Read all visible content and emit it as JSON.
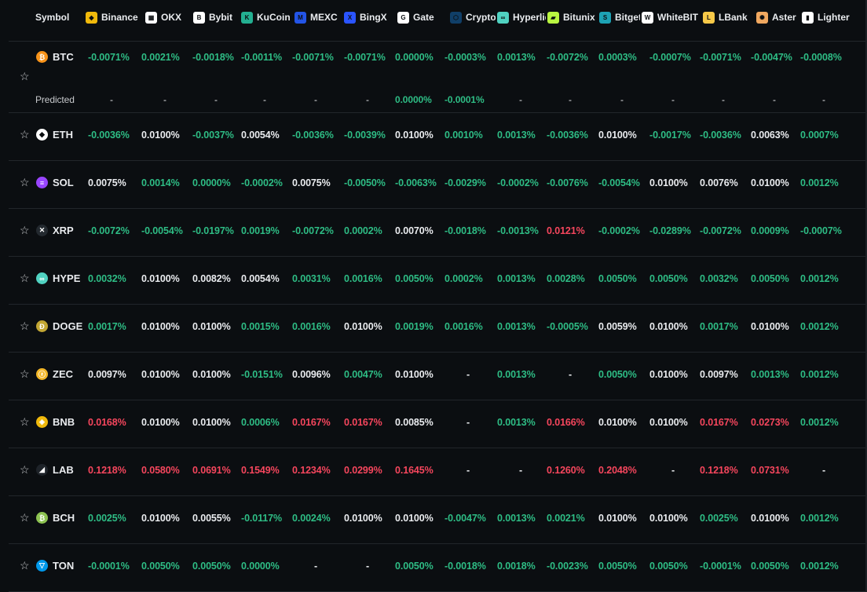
{
  "header": {
    "symbol_label": "Symbol",
    "exchanges": [
      {
        "name": "Binance",
        "icon": "binance-icon",
        "color": "#f0b90b"
      },
      {
        "name": "OKX",
        "icon": "okx-icon",
        "color": "#ffffff"
      },
      {
        "name": "Bybit",
        "icon": "bybit-icon",
        "color": "#ffffff"
      },
      {
        "name": "KuCoin",
        "icon": "kucoin-icon",
        "color": "#23af91"
      },
      {
        "name": "MEXC",
        "icon": "mexc-icon",
        "color": "#2354e6"
      },
      {
        "name": "BingX",
        "icon": "bingx-icon",
        "color": "#2a54ff"
      },
      {
        "name": "Gate",
        "icon": "gate-icon",
        "color": "#ffffff"
      },
      {
        "name": "Crypto.com",
        "icon": "cryptocom-icon",
        "color": "#103f68"
      },
      {
        "name": "Hyperliqui",
        "icon": "hyperliquid-icon",
        "color": "#50d2c1"
      },
      {
        "name": "Bitunix",
        "icon": "bitunix-icon",
        "color": "#b9f641"
      },
      {
        "name": "Bitget",
        "icon": "bitget-icon",
        "color": "#1da2b4"
      },
      {
        "name": "WhiteBIT",
        "icon": "whitebit-icon",
        "color": "#ffffff"
      },
      {
        "name": "LBank",
        "icon": "lbank-icon",
        "color": "#f7c948"
      },
      {
        "name": "Aster",
        "icon": "aster-icon",
        "color": "#f0a860"
      },
      {
        "name": "Lighter",
        "icon": "lighter-icon",
        "color": "#ffffff"
      }
    ]
  },
  "colors": {
    "positive": "#2ebd85",
    "negative": "#f6465d",
    "neutral": "#eaecef",
    "background": "#0b0e11"
  },
  "predicted_label": "Predicted",
  "rows": [
    {
      "symbol": "BTC",
      "icon": "btc-icon",
      "coin_color": "#f7931a",
      "values": [
        "-0.0071%",
        "0.0021%",
        "-0.0018%",
        "-0.0011%",
        "-0.0071%",
        "-0.0071%",
        "0.0000%",
        "-0.0003%",
        "0.0013%",
        "-0.0072%",
        "0.0003%",
        "-0.0007%",
        "-0.0071%",
        "-0.0047%",
        "-0.0008%"
      ],
      "tones": [
        "pos",
        "pos",
        "pos",
        "pos",
        "pos",
        "pos",
        "pos",
        "pos",
        "pos",
        "pos",
        "pos",
        "pos",
        "pos",
        "pos",
        "pos"
      ],
      "predicted": [
        "-",
        "-",
        "-",
        "-",
        "-",
        "-",
        "0.0000%",
        "-0.0001%",
        "-",
        "-",
        "-",
        "-",
        "-",
        "-",
        "-"
      ],
      "predicted_tones": [
        "pred",
        "pred",
        "pred",
        "pred",
        "pred",
        "pred",
        "pos",
        "pos",
        "pred",
        "pred",
        "pred",
        "pred",
        "pred",
        "pred",
        "pred"
      ]
    },
    {
      "symbol": "ETH",
      "icon": "eth-icon",
      "coin_color": "#ffffff",
      "values": [
        "-0.0036%",
        "0.0100%",
        "-0.0037%",
        "0.0054%",
        "-0.0036%",
        "-0.0039%",
        "0.0100%",
        "0.0010%",
        "0.0013%",
        "-0.0036%",
        "0.0100%",
        "-0.0017%",
        "-0.0036%",
        "0.0063%",
        "0.0007%"
      ],
      "tones": [
        "pos",
        "neu",
        "pos",
        "neu",
        "pos",
        "pos",
        "neu",
        "pos",
        "pos",
        "pos",
        "neu",
        "pos",
        "pos",
        "neu",
        "pos"
      ]
    },
    {
      "symbol": "SOL",
      "icon": "sol-icon",
      "coin_color": "#9945ff",
      "values": [
        "0.0075%",
        "0.0014%",
        "0.0000%",
        "-0.0002%",
        "0.0075%",
        "-0.0050%",
        "-0.0063%",
        "-0.0029%",
        "-0.0002%",
        "-0.0076%",
        "-0.0054%",
        "0.0100%",
        "0.0076%",
        "0.0100%",
        "0.0012%"
      ],
      "tones": [
        "neu",
        "pos",
        "pos",
        "pos",
        "neu",
        "pos",
        "pos",
        "pos",
        "pos",
        "pos",
        "pos",
        "neu",
        "neu",
        "neu",
        "pos"
      ]
    },
    {
      "symbol": "XRP",
      "icon": "xrp-icon",
      "coin_color": "#23292f",
      "values": [
        "-0.0072%",
        "-0.0054%",
        "-0.0197%",
        "0.0019%",
        "-0.0072%",
        "0.0002%",
        "0.0070%",
        "-0.0018%",
        "-0.0013%",
        "0.0121%",
        "-0.0002%",
        "-0.0289%",
        "-0.0072%",
        "0.0009%",
        "-0.0007%"
      ],
      "tones": [
        "pos",
        "pos",
        "pos",
        "pos",
        "pos",
        "pos",
        "neu",
        "pos",
        "pos",
        "neg",
        "pos",
        "pos",
        "pos",
        "pos",
        "pos"
      ]
    },
    {
      "symbol": "HYPE",
      "icon": "hype-icon",
      "coin_color": "#50d2c1",
      "values": [
        "0.0032%",
        "0.0100%",
        "0.0082%",
        "0.0054%",
        "0.0031%",
        "0.0016%",
        "0.0050%",
        "0.0002%",
        "0.0013%",
        "0.0028%",
        "0.0050%",
        "0.0050%",
        "0.0032%",
        "0.0050%",
        "0.0012%"
      ],
      "tones": [
        "pos",
        "neu",
        "neu",
        "neu",
        "pos",
        "pos",
        "pos",
        "pos",
        "pos",
        "pos",
        "pos",
        "pos",
        "pos",
        "pos",
        "pos"
      ]
    },
    {
      "symbol": "DOGE",
      "icon": "doge-icon",
      "coin_color": "#c2a633",
      "values": [
        "0.0017%",
        "0.0100%",
        "0.0100%",
        "0.0015%",
        "0.0016%",
        "0.0100%",
        "0.0019%",
        "0.0016%",
        "0.0013%",
        "-0.0005%",
        "0.0059%",
        "0.0100%",
        "0.0017%",
        "0.0100%",
        "0.0012%"
      ],
      "tones": [
        "pos",
        "neu",
        "neu",
        "pos",
        "pos",
        "neu",
        "pos",
        "pos",
        "pos",
        "pos",
        "neu",
        "neu",
        "pos",
        "neu",
        "pos"
      ]
    },
    {
      "symbol": "ZEC",
      "icon": "zec-icon",
      "coin_color": "#f4b728",
      "values": [
        "0.0097%",
        "0.0100%",
        "0.0100%",
        "-0.0151%",
        "0.0096%",
        "0.0047%",
        "0.0100%",
        "-",
        "0.0013%",
        "-",
        "0.0050%",
        "0.0100%",
        "0.0097%",
        "0.0013%",
        "0.0012%"
      ],
      "tones": [
        "neu",
        "neu",
        "neu",
        "pos",
        "neu",
        "pos",
        "neu",
        "neu",
        "pos",
        "neu",
        "pos",
        "neu",
        "neu",
        "pos",
        "pos"
      ]
    },
    {
      "symbol": "BNB",
      "icon": "bnb-icon",
      "coin_color": "#f0b90b",
      "values": [
        "0.0168%",
        "0.0100%",
        "0.0100%",
        "0.0006%",
        "0.0167%",
        "0.0167%",
        "0.0085%",
        "-",
        "0.0013%",
        "0.0166%",
        "0.0100%",
        "0.0100%",
        "0.0167%",
        "0.0273%",
        "0.0012%"
      ],
      "tones": [
        "neg",
        "neu",
        "neu",
        "pos",
        "neg",
        "neg",
        "neu",
        "neu",
        "pos",
        "neg",
        "neu",
        "neu",
        "neg",
        "neg",
        "pos"
      ]
    },
    {
      "symbol": "LAB",
      "icon": "lab-icon",
      "coin_color": "#1e2329",
      "values": [
        "0.1218%",
        "0.0580%",
        "0.0691%",
        "0.1549%",
        "0.1234%",
        "0.0299%",
        "0.1645%",
        "-",
        "-",
        "0.1260%",
        "0.2048%",
        "-",
        "0.1218%",
        "0.0731%",
        "-"
      ],
      "tones": [
        "neg",
        "neg",
        "neg",
        "neg",
        "neg",
        "neg",
        "neg",
        "neu",
        "neu",
        "neg",
        "neg",
        "neu",
        "neg",
        "neg",
        "neu"
      ]
    },
    {
      "symbol": "BCH",
      "icon": "bch-icon",
      "coin_color": "#8dc351",
      "values": [
        "0.0025%",
        "0.0100%",
        "0.0055%",
        "-0.0117%",
        "0.0024%",
        "0.0100%",
        "0.0100%",
        "-0.0047%",
        "0.0013%",
        "0.0021%",
        "0.0100%",
        "0.0100%",
        "0.0025%",
        "0.0100%",
        "0.0012%"
      ],
      "tones": [
        "pos",
        "neu",
        "neu",
        "pos",
        "pos",
        "neu",
        "neu",
        "pos",
        "pos",
        "pos",
        "neu",
        "neu",
        "pos",
        "neu",
        "pos"
      ]
    },
    {
      "symbol": "TON",
      "icon": "ton-icon",
      "coin_color": "#0098ea",
      "values": [
        "-0.0001%",
        "0.0050%",
        "0.0050%",
        "0.0000%",
        "-",
        "-",
        "0.0050%",
        "-0.0018%",
        "0.0018%",
        "-0.0023%",
        "0.0050%",
        "0.0050%",
        "-0.0001%",
        "0.0050%",
        "0.0012%"
      ],
      "tones": [
        "pos",
        "pos",
        "pos",
        "pos",
        "neu",
        "neu",
        "pos",
        "pos",
        "pos",
        "pos",
        "pos",
        "pos",
        "pos",
        "pos",
        "pos"
      ]
    }
  ]
}
